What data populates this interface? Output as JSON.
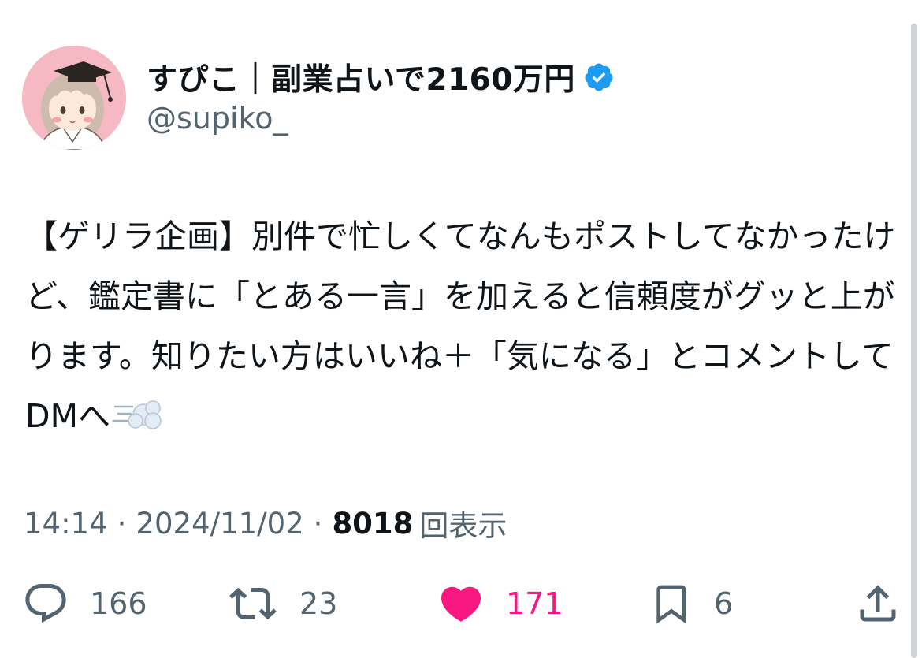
{
  "author": {
    "display_name": "すぴこ｜副業占いで2160万円",
    "handle": "@supiko_",
    "avatar_icon": "avatar-illustration-icon",
    "verified_icon": "verified-badge-icon",
    "verified_color": "#1d9bf0"
  },
  "tweet": {
    "text": "【ゲリラ企画】別件で忙しくてなんもポストしてなかったけど、鑑定書に「とある一言」を加えると信頼度がグッと上がります。知りたい方はいいね＋「気になる」とコメントしてDMへ",
    "emoji_icon": "dash-symbol-icon"
  },
  "meta": {
    "time": "14:14",
    "separator": "·",
    "date": "2024/11/02",
    "views_count": "8018",
    "views_label": "回表示"
  },
  "actions": {
    "reply_count": "166",
    "repost_count": "23",
    "like_count": "171",
    "bookmark_count": "6",
    "like_color": "#f91880",
    "muted_color": "#536471"
  }
}
